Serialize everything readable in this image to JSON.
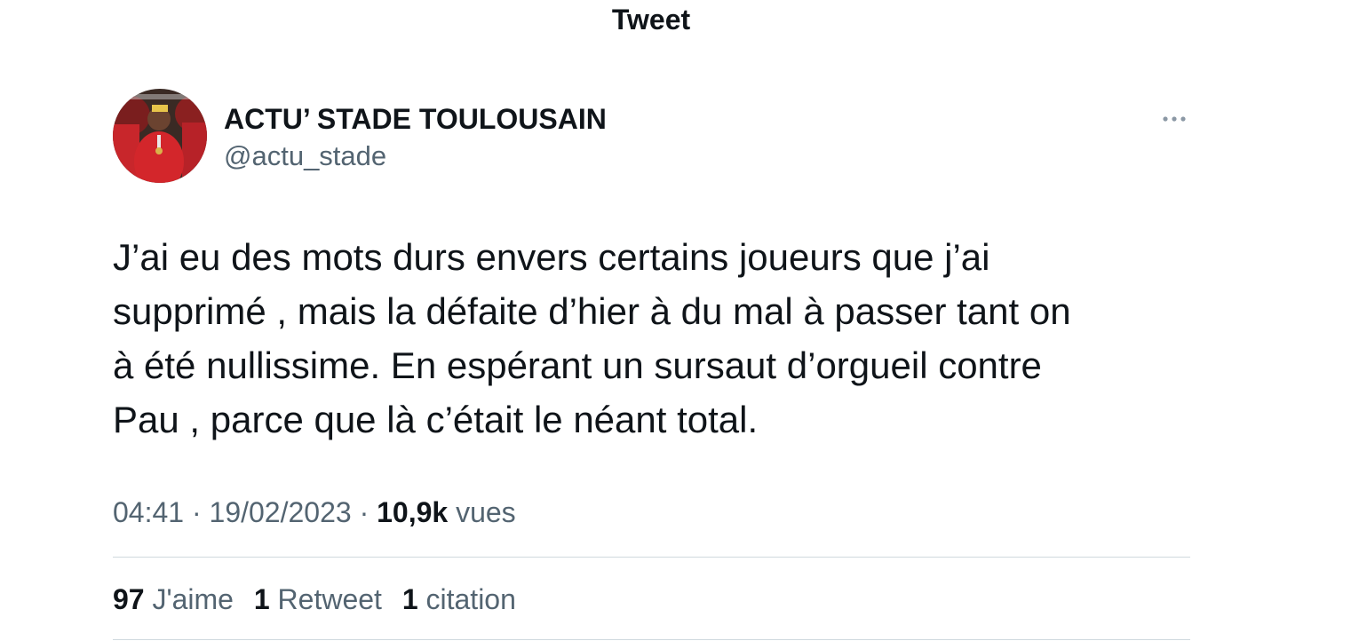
{
  "header": {
    "title": "Tweet"
  },
  "author": {
    "display_name": "ACTU’ STADE TOULOUSAIN",
    "handle": "@actu_stade"
  },
  "tweet": {
    "lines": [
      "J’ai eu des mots durs envers certains joueurs que j’ai",
      "supprimé , mais la défaite d’hier à du mal à passer tant on",
      "à été nullissime. En espérant un sursaut d’orgueil contre",
      "Pau , parce que là c’était le néant total."
    ]
  },
  "meta": {
    "time": "04:41",
    "separator": "·",
    "date": "19/02/2023",
    "views_count": "10,9k",
    "views_label": "vues"
  },
  "stats": {
    "likes_count": "97",
    "likes_label": "J'aime",
    "retweets_count": "1",
    "retweets_label": "Retweet",
    "quotes_count": "1",
    "quotes_label": "citation"
  },
  "icons": {
    "more": "more-horizontal-icon"
  },
  "colors": {
    "text_primary": "#0f1419",
    "text_secondary": "#536471",
    "divider": "#cfd9de",
    "avatar_red": "#d3262b"
  }
}
